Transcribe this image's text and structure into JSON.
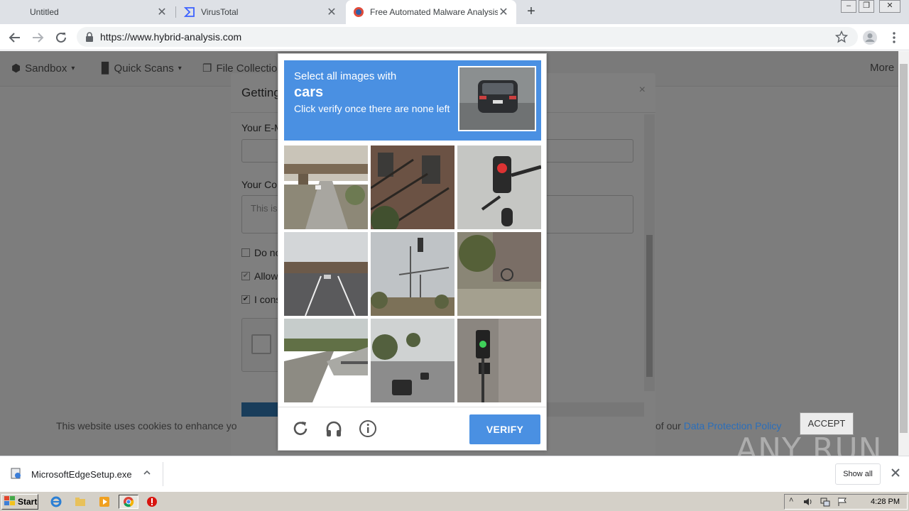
{
  "browser": {
    "tabs": [
      {
        "title": "Untitled",
        "active": false
      },
      {
        "title": "VirusTotal",
        "active": false
      },
      {
        "title": "Free Automated Malware Analysis Se",
        "active": true
      }
    ],
    "url": "https://www.hybrid-analysis.com"
  },
  "site": {
    "nav": [
      "Sandbox",
      "Quick Scans",
      "File Collections",
      "More"
    ],
    "modal": {
      "title": "Getting",
      "email_label": "Your E-M",
      "comment_label": "Your Con",
      "comment_placeholder": "This is",
      "checkboxes": [
        {
          "label": "Do no",
          "checked": false
        },
        {
          "label": "Allow",
          "checked": true
        },
        {
          "label": "I cons",
          "checked": true
        }
      ],
      "close": "×"
    },
    "cookie": {
      "text": "This website uses cookies to enhance yo",
      "text_suffix": "of our",
      "link": "Data Protection Policy",
      "accept": "ACCEPT"
    }
  },
  "captcha": {
    "line1": "Select all images with",
    "target": "cars",
    "line3": "Click verify once there are none left",
    "verify": "VERIFY",
    "tiles": [
      "overpass-highway",
      "fire-escape-building",
      "traffic-light-red",
      "highway-overpass",
      "street-traffic-light",
      "sidewalk-trees",
      "bridge-road",
      "road-with-cars",
      "traffic-light-green"
    ]
  },
  "downloads": {
    "file": "MicrosoftEdgeSetup.exe",
    "show_all": "Show all"
  },
  "watermark": "ANY RUN",
  "taskbar": {
    "start": "Start",
    "time": "4:28 PM"
  }
}
